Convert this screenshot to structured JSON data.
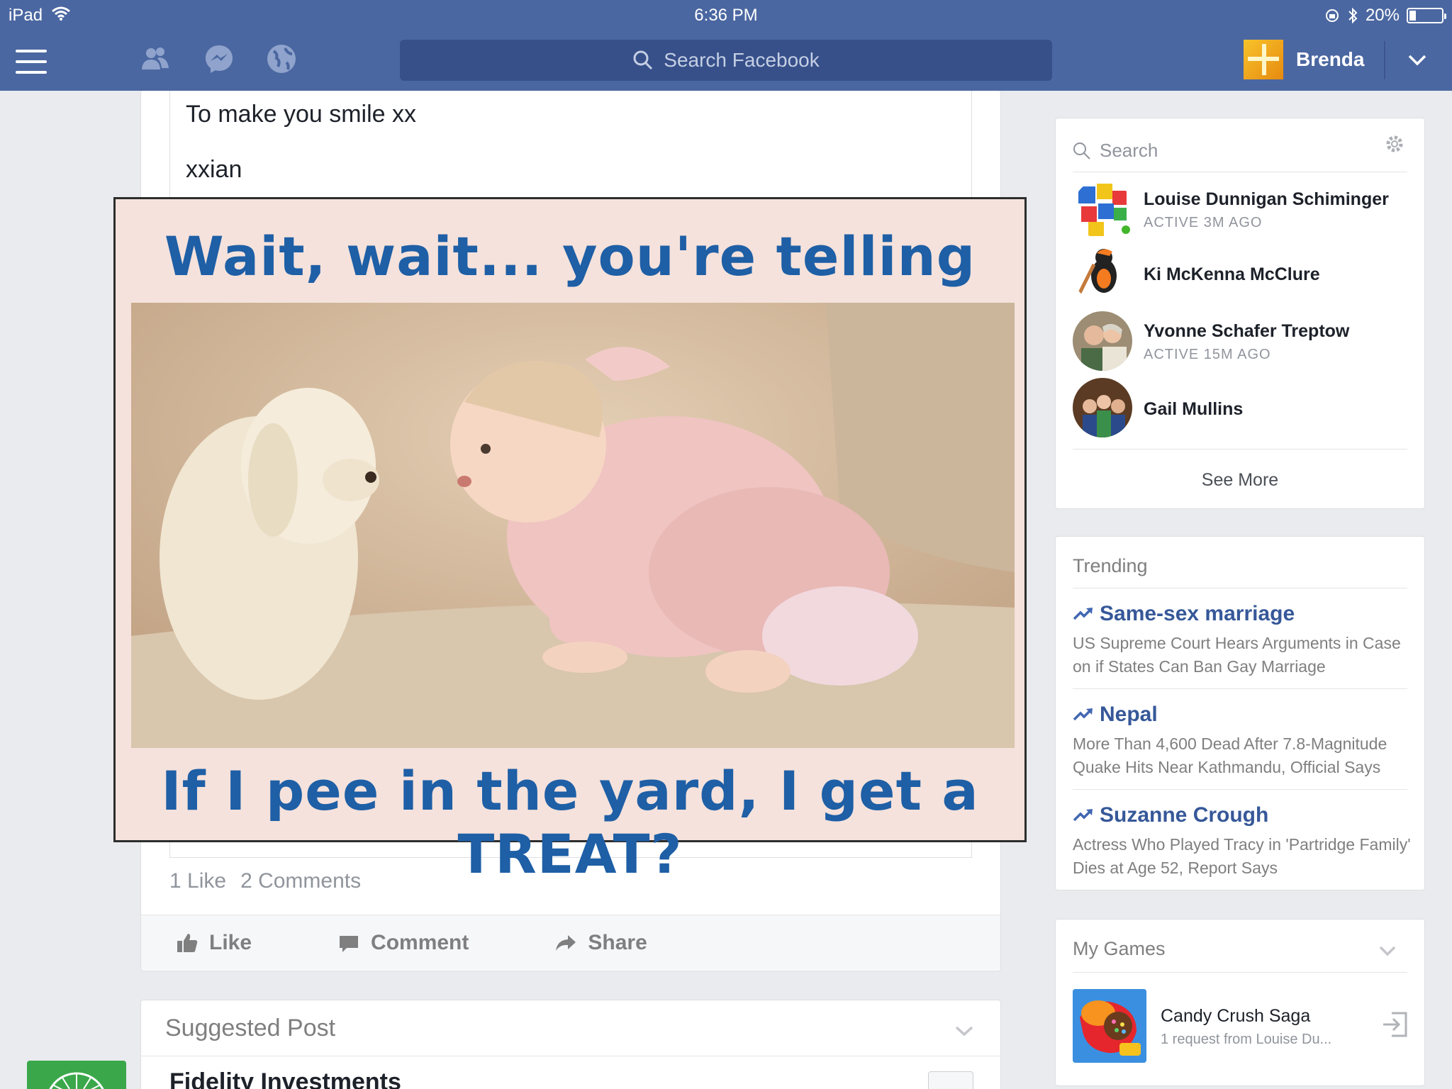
{
  "status": {
    "device": "iPad",
    "time": "6:36 PM",
    "battery": "20%",
    "battery_level": 0.2
  },
  "nav": {
    "search_placeholder": "Search Facebook",
    "user_name": "Brenda"
  },
  "post": {
    "message_line1": "To make you smile xx",
    "message_line2": "xxian",
    "meme_top": "Wait, wait... you're telling me...",
    "meme_bottom": "If I pee in the yard, I get a TREAT?",
    "likes": "1 Like",
    "comments": "2 Comments",
    "actions": {
      "like": "Like",
      "comment": "Comment",
      "share": "Share"
    }
  },
  "suggested": {
    "header": "Suggested Post",
    "name": "Fidelity Investments"
  },
  "chat": {
    "search_placeholder": "Search",
    "friends": [
      {
        "name": "Louise Dunnigan Schiminger",
        "status": "ACTIVE 3M AGO"
      },
      {
        "name": "Ki McKenna McClure",
        "status": ""
      },
      {
        "name": "Yvonne Schafer Treptow",
        "status": "ACTIVE 15M AGO"
      },
      {
        "name": "Gail Mullins",
        "status": ""
      }
    ],
    "see_more": "See More"
  },
  "trending": {
    "title": "Trending",
    "topics": [
      {
        "name": "Same-sex marriage",
        "desc": "US Supreme Court Hears Arguments in Case on if States Can Ban Gay Marriage"
      },
      {
        "name": "Nepal",
        "desc": "More Than 4,600 Dead After 7.8-Magnitude Quake Hits Near Kathmandu, Official Says"
      },
      {
        "name": "Suzanne Crough",
        "desc": "Actress Who Played Tracy in 'Partridge Family' Dies at Age 52, Report Says"
      }
    ]
  },
  "games": {
    "title": "My Games",
    "items": [
      {
        "name": "Candy Crush Saga",
        "sub": "1 request from Louise Du..."
      }
    ]
  },
  "colors": {
    "facebook_blue": "#4b67a1",
    "link_blue": "#365899",
    "meme_text": "#1e5fa6",
    "online_green": "#42b72a"
  }
}
